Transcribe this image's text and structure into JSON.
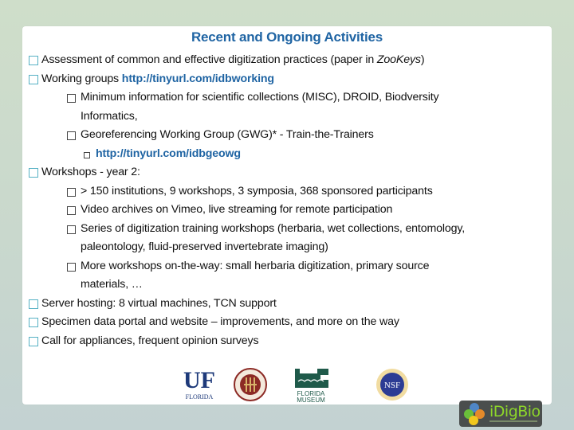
{
  "slide": {
    "title": "Recent and Ongoing Activities",
    "items": [
      {
        "level": 1,
        "text": "Assessment of common and effective digitization practices (paper in ",
        "italic": "ZooKeys",
        "after": ")"
      },
      {
        "level": 1,
        "text": "Working groups ",
        "link": "http://tinyurl.com/idbworking"
      },
      {
        "level": 2,
        "text": "Minimum information for scientific collections (MISC), DROID, Biodversity",
        "cont": "Informatics,"
      },
      {
        "level": 2,
        "text": "Georeferencing Working Group (GWG)* - Train-the-Trainers"
      },
      {
        "level": 3,
        "link": "http://tinyurl.com/idbgeowg"
      },
      {
        "level": 1,
        "text": "Workshops  - year 2:"
      },
      {
        "level": 2,
        "text": "> 150 institutions, 9 workshops, 3 symposia, 368 sponsored participants"
      },
      {
        "level": 2,
        "text": "Video archives on Vimeo, live streaming for remote participation"
      },
      {
        "level": 2,
        "text": "Series of digitization training workshops (herbaria, wet collections, entomology,",
        "cont": "paleontology, fluid-preserved invertebrate imaging)"
      },
      {
        "level": 2,
        "text": "More workshops on-the-way: small herbaria digitization, primary source",
        "cont": "materials, …"
      },
      {
        "level": 1,
        "text": "Server hosting: 8 virtual machines, TCN support"
      },
      {
        "level": 1,
        "text": "Specimen data portal and website – improvements, and more on the way"
      },
      {
        "level": 1,
        "text": "Call for appliances, frequent opinion surveys"
      }
    ]
  },
  "logos": {
    "uf": {
      "mark": "UF",
      "sub": "FLORIDA"
    },
    "fsu": {
      "name": "fsu-seal"
    },
    "flmnh": {
      "line1": "FLORIDA",
      "line2": "MUSEUM"
    },
    "nsf": {
      "mark": "NSF"
    },
    "idigbio": {
      "word": "iDigBio"
    }
  },
  "colors": {
    "title": "#1f64a3",
    "link": "#1f64a3",
    "bullet_l1": "#56b1c4",
    "idigbio_green": "#8dd62a"
  }
}
